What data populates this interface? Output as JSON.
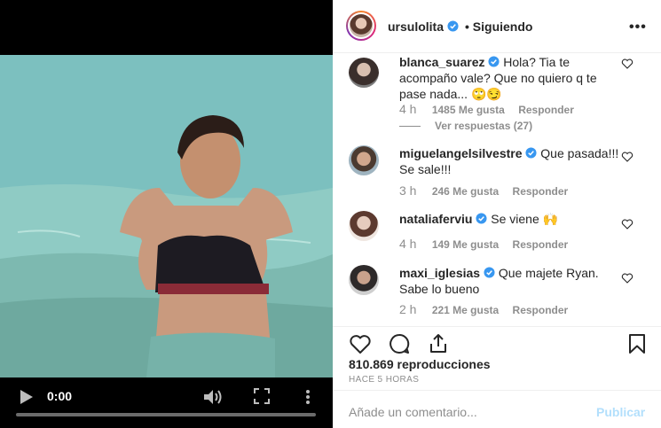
{
  "video": {
    "time": "0:00",
    "progress": 0
  },
  "post": {
    "username": "ursulolita",
    "separator": "•",
    "follow_status": "Siguiendo",
    "more": "•••"
  },
  "comments": [
    {
      "username": "blanca_suarez",
      "text": "Hola? Tia te acompaño vale? Que no quiero q te pase nada... 🙄😏",
      "time": "4 h",
      "likes": "1485 Me gusta",
      "reply": "Responder",
      "view_replies": "Ver respuestas (27)"
    },
    {
      "username": "miguelangelsilvestre",
      "text": "Que pasada!!! Se sale!!!",
      "time": "3 h",
      "likes": "246 Me gusta",
      "reply": "Responder"
    },
    {
      "username": "nataliaferviu",
      "text": "Se viene 🙌",
      "time": "4 h",
      "likes": "149 Me gusta",
      "reply": "Responder"
    },
    {
      "username": "maxi_iglesias",
      "text": "Que majete Ryan. Sabe lo bueno",
      "time": "2 h",
      "likes": "221 Me gusta",
      "reply": "Responder"
    }
  ],
  "actions": {
    "views": "810.869 reproducciones",
    "date": "HACE 5 HORAS"
  },
  "add_comment": {
    "placeholder": "Añade un comentario...",
    "publish": "Publicar"
  },
  "colors": {
    "verified": "#3897f0",
    "publish_disabled": "#b2dffc",
    "meta_gray": "#8e8e8e"
  }
}
